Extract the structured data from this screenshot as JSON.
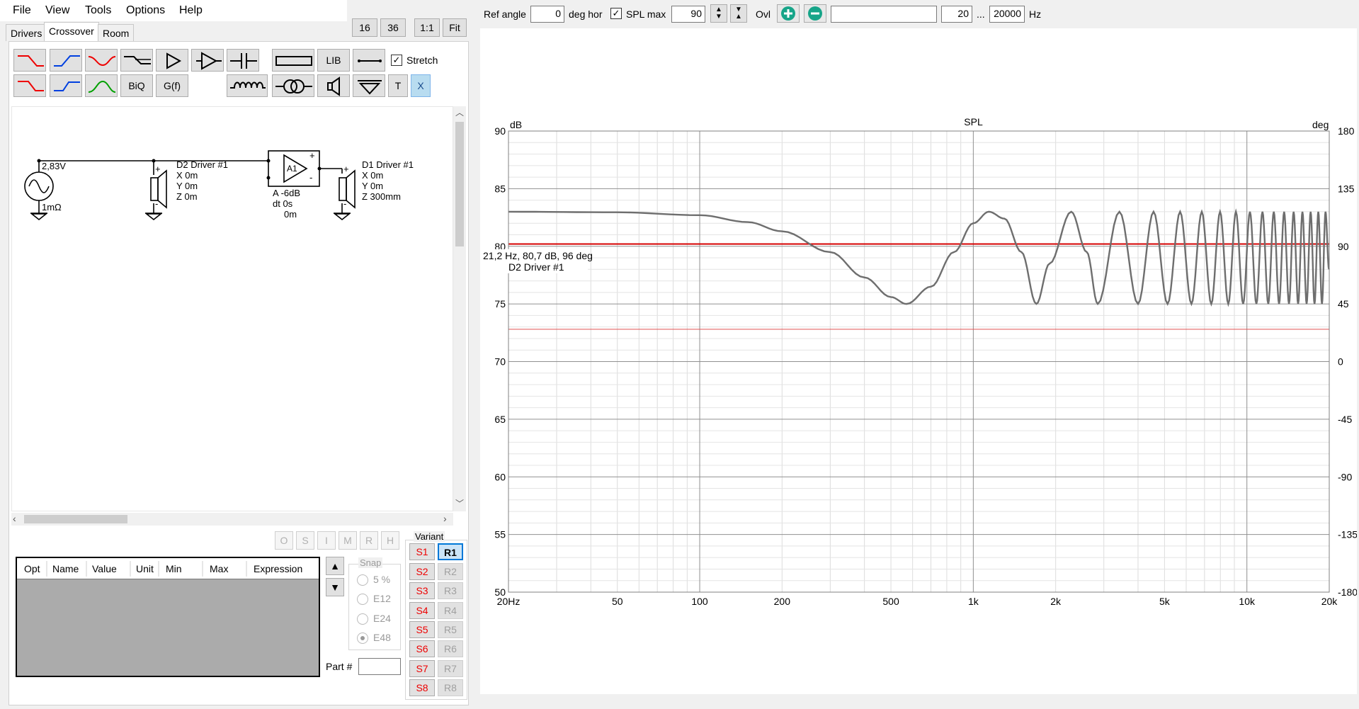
{
  "menu": {
    "file": "File",
    "view": "View",
    "tools": "Tools",
    "options": "Options",
    "help": "Help"
  },
  "tabs": {
    "drivers": "Drivers",
    "crossover": "Crossover",
    "room": "Room"
  },
  "zoom_buttons": {
    "b16": "16",
    "b36": "36",
    "b11": "1:1",
    "fit": "Fit"
  },
  "toolbar": {
    "biq": "BiQ",
    "gf": "G(f)",
    "lib": "LIB",
    "t": "T",
    "x": "X",
    "stretch_label": "Stretch",
    "stretch_checked": true
  },
  "schematic": {
    "source_voltage": "2,83V",
    "source_impedance": "1mΩ",
    "d2_name": "D2 Driver #1",
    "d2_x": "X 0m",
    "d2_y": "Y 0m",
    "d2_z": "Z 0m",
    "amp_label": "A1",
    "amp_gain": "A  -6dB",
    "amp_delay": "dt 0s",
    "amp_distance": "0m",
    "d1_name": "D1 Driver #1",
    "d1_x": "X 0m",
    "d1_y": "Y 0m",
    "d1_z": "Z 300mm"
  },
  "op_buttons": [
    "O",
    "S",
    "I",
    "M",
    "R",
    "H"
  ],
  "table": {
    "columns": [
      "Opt",
      "Name",
      "Value",
      "Unit",
      "Min",
      "Max",
      "Expression"
    ]
  },
  "snap": {
    "title": "Snap",
    "options": [
      "5 %",
      "E12",
      "E24",
      "E48"
    ],
    "selected": "E48"
  },
  "part_label": "Part #",
  "part_value": "",
  "variant": {
    "title": "Variant",
    "s": [
      "S1",
      "S2",
      "S3",
      "S4",
      "S5",
      "S6",
      "S7",
      "S8"
    ],
    "r": [
      "R1",
      "R2",
      "R3",
      "R4",
      "R5",
      "R6",
      "R7",
      "R8"
    ],
    "active_r": "R1"
  },
  "graph_bar": {
    "ref_angle_label": "Ref angle",
    "ref_angle_value": "0",
    "deg_hor_label": "deg hor",
    "spl_max_label": "SPL max",
    "spl_max_checked": true,
    "spl_max_value": "90",
    "ovl_label": "Ovl",
    "overlay_name": "",
    "freq_min": "20",
    "range_sep": "...",
    "freq_max": "20000",
    "hz_label": "Hz"
  },
  "chart_data": {
    "type": "line",
    "title": "SPL",
    "ylabel": "dB",
    "y2label": "deg",
    "xscale": "log",
    "xlim": [
      20,
      20000
    ],
    "ylim": [
      50,
      90
    ],
    "y2lim": [
      -180,
      180
    ],
    "grid": true,
    "x_ticks": [
      "20Hz",
      "50",
      "100",
      "200",
      "500",
      "1k",
      "2k",
      "5k",
      "10k",
      "20k"
    ],
    "x_tick_values": [
      20,
      50,
      100,
      200,
      500,
      1000,
      2000,
      5000,
      10000,
      20000
    ],
    "y_ticks": [
      50,
      55,
      60,
      65,
      70,
      75,
      80,
      85,
      90
    ],
    "y2_ticks": [
      -180,
      -135,
      -90,
      -45,
      0,
      45,
      90,
      135,
      180
    ],
    "cursor_readout": "21,2 Hz, 80,7 dB, 96 deg",
    "cursor_series": "D2 Driver #1",
    "series": [
      {
        "color": "#6e6e6e",
        "description": "comb-filtered SPL: ~83 dB flat at LF, first null 75 dB at ~570 Hz, peaks ~83 dB, nulls ~75 dB repeating (delay 0.3 m)",
        "points": [
          [
            20,
            83.0
          ],
          [
            50,
            82.95
          ],
          [
            100,
            82.7
          ],
          [
            150,
            82.1
          ],
          [
            200,
            81.3
          ],
          [
            300,
            79.5
          ],
          [
            400,
            77.3
          ],
          [
            500,
            75.6
          ],
          [
            570,
            75.0
          ],
          [
            700,
            76.5
          ],
          [
            850,
            79.5
          ],
          [
            1000,
            82.0
          ],
          [
            1140,
            83.0
          ],
          [
            1300,
            82.4
          ],
          [
            1500,
            79.5
          ],
          [
            1700,
            75.0
          ],
          [
            1900,
            78.5
          ],
          [
            2280,
            83.0
          ],
          [
            2600,
            79.5
          ],
          [
            2850,
            75.0
          ],
          [
            3420,
            83.0
          ],
          [
            4000,
            75.0
          ],
          [
            4560,
            83.0
          ],
          [
            5130,
            75.0
          ],
          [
            5700,
            83.0
          ],
          [
            6270,
            75.0
          ],
          [
            6840,
            83.0
          ],
          [
            7410,
            75.0
          ],
          [
            7980,
            83.0
          ],
          [
            8550,
            75.0
          ],
          [
            9120,
            83.0
          ],
          [
            9690,
            75.0
          ],
          [
            10260,
            83.0
          ],
          [
            10830,
            75.0
          ],
          [
            11400,
            83.0
          ],
          [
            11970,
            75.0
          ],
          [
            12540,
            83.0
          ],
          [
            13110,
            75.0
          ],
          [
            13680,
            83.0
          ],
          [
            14250,
            75.0
          ],
          [
            14820,
            83.0
          ],
          [
            15390,
            75.0
          ],
          [
            15960,
            83.0
          ],
          [
            16530,
            75.0
          ],
          [
            17100,
            83.0
          ],
          [
            17670,
            75.0
          ],
          [
            18240,
            83.0
          ],
          [
            18810,
            75.0
          ],
          [
            19380,
            83.0
          ],
          [
            19950,
            78.0
          ]
        ]
      }
    ],
    "reference_lines": [
      {
        "color": "#d40000",
        "value": 80.2,
        "width": 2
      },
      {
        "color": "#e05050",
        "value": 72.8,
        "width": 1
      }
    ]
  }
}
